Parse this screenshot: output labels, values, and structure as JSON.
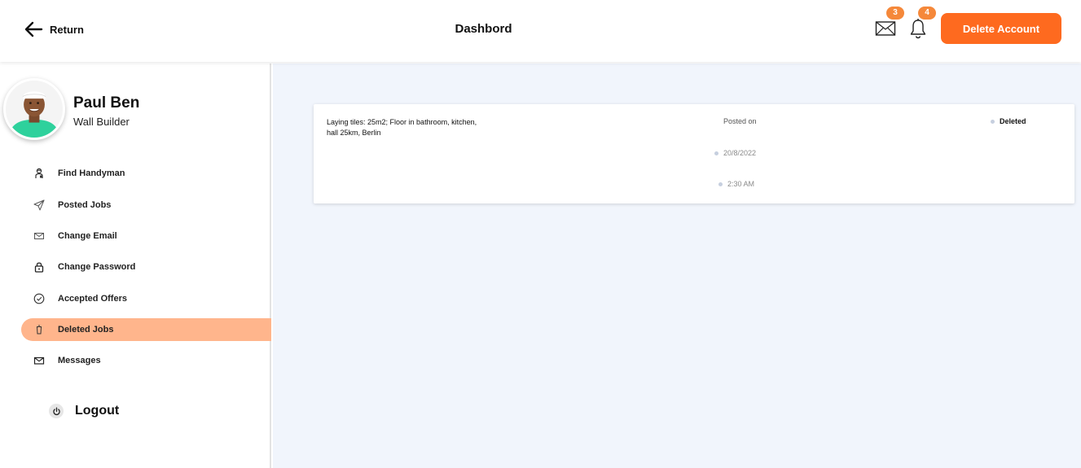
{
  "header": {
    "return_label": "Return",
    "title": "Dashbord",
    "mail_count": "3",
    "notification_count": "4",
    "delete_account_label": "Delete Account",
    "icons": {
      "return": "arrow-left-icon",
      "mail": "envelope-icon",
      "notifications": "bell-icon"
    }
  },
  "profile": {
    "name": "Paul Ben",
    "role": "Wall Builder"
  },
  "sidebar": {
    "items": [
      {
        "label": "Find Handyman",
        "icon": "worker-icon"
      },
      {
        "label": "Posted Jobs",
        "icon": "send-icon"
      },
      {
        "label": "Change Email",
        "icon": "envelope-icon"
      },
      {
        "label": "Change Password",
        "icon": "lock-icon"
      },
      {
        "label": "Accepted Offers",
        "icon": "check-circle-icon"
      },
      {
        "label": "Deleted Jobs",
        "icon": "trash-icon",
        "active": true
      },
      {
        "label": "Messages",
        "icon": "envelope-icon"
      }
    ],
    "logout_label": "Logout"
  },
  "job": {
    "description": "Laying tiles: 25m2; Floor in bathroom, kitchen, hall 25km, Berlin",
    "posted_on_label": "Posted on",
    "date": "20/8/2022",
    "time": "2:30 AM",
    "status": "Deleted"
  },
  "colors": {
    "accent": "#fe6a1f",
    "badge": "#f5883a",
    "active_item": "#ffb58c",
    "main_background": "#f1f5fc"
  }
}
